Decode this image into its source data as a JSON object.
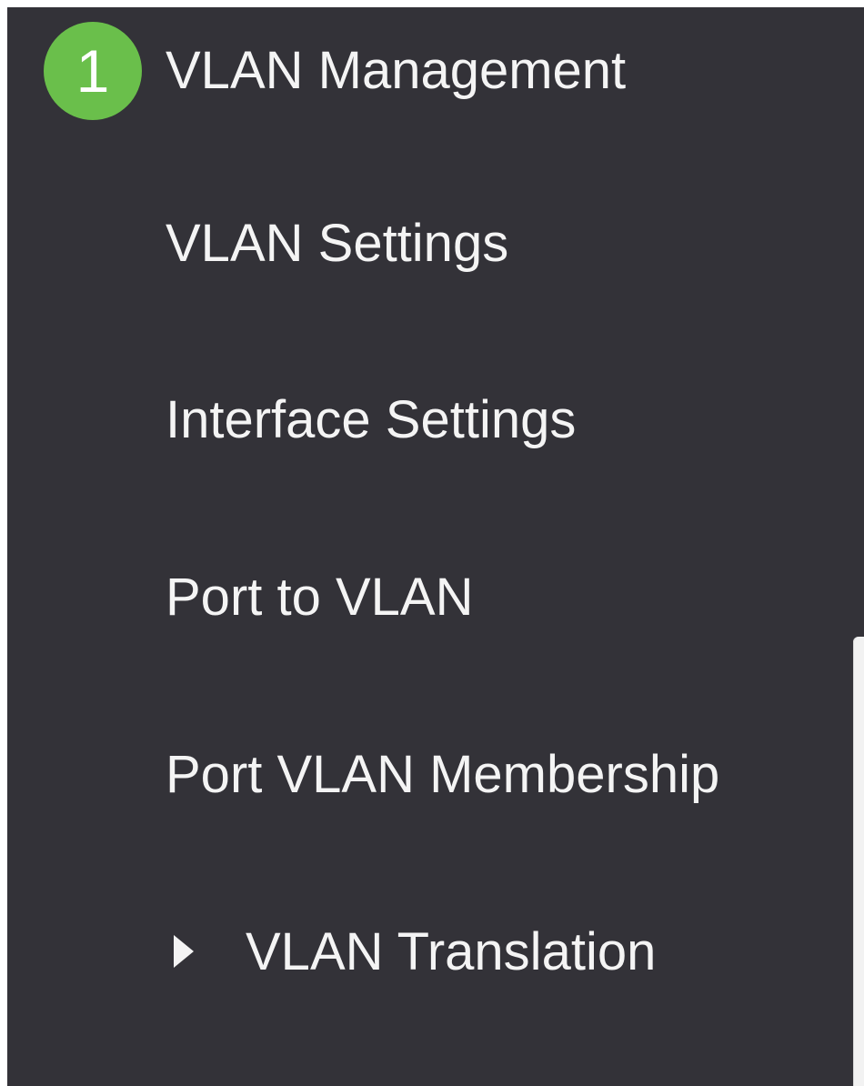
{
  "sidebar": {
    "header": {
      "step_number": "1",
      "title": "VLAN Management"
    },
    "items": [
      {
        "label": "VLAN Settings"
      },
      {
        "label": "Interface Settings"
      },
      {
        "label": "Port to VLAN"
      },
      {
        "label": "Port VLAN Membership"
      },
      {
        "label": "VLAN Translation",
        "icon": "caret-right-icon",
        "expandable": true
      }
    ]
  },
  "colors": {
    "sidebar_background": "#333238",
    "text": "#f4f4f4",
    "step_badge": "#6abf4b"
  }
}
